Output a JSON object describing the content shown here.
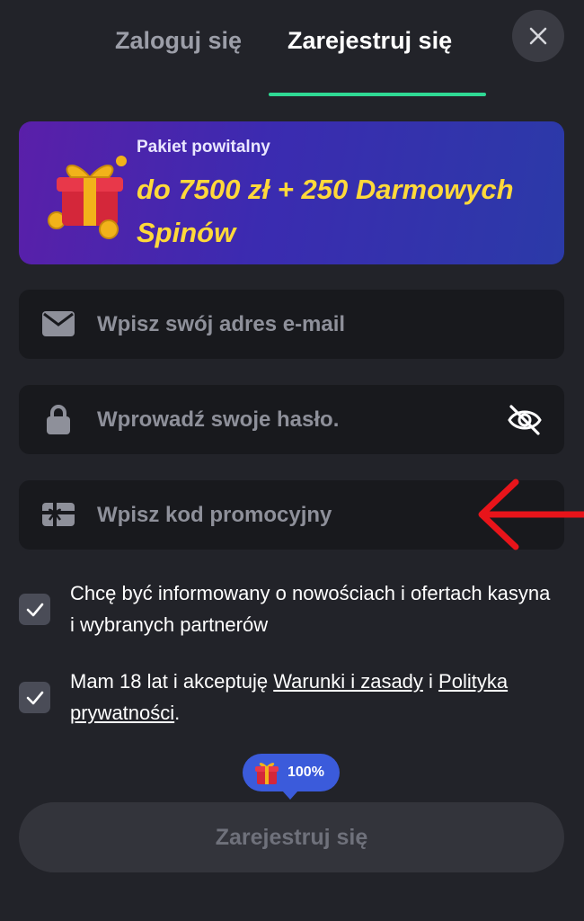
{
  "tabs": {
    "login": "Zaloguj się",
    "register": "Zarejestruj się"
  },
  "banner": {
    "subtitle": "Pakiet powitalny",
    "title": "do 7500 zł + 250 Darmowych Spinów"
  },
  "fields": {
    "email": {
      "placeholder": "Wpisz swój adres e-mail",
      "value": ""
    },
    "password": {
      "placeholder": "Wprowadź swoje hasło.",
      "value": ""
    },
    "promo": {
      "placeholder": "Wpisz kod promocyjny",
      "value": ""
    }
  },
  "checks": {
    "marketing": {
      "text": "Chcę być informowany o nowościach i ofertach kasyna i wybranych partnerów",
      "checked": true
    },
    "terms": {
      "prefix": "Mam 18 lat i akceptuję ",
      "link1": "Warunki i zasady",
      "middle": " i ",
      "link2": "Polityka prywatności",
      "suffix": ".",
      "checked": true
    }
  },
  "bonus": {
    "percent": "100%"
  },
  "submit": {
    "label": "Zarejestruj się"
  },
  "icons": {
    "close": "close-icon",
    "email": "envelope-icon",
    "password": "lock-icon",
    "promo": "gift-card-icon",
    "eye": "eye-off-icon"
  },
  "colors": {
    "accent": "#2fd994",
    "banner_title": "#ffd93a",
    "bonus_bubble": "#3b5bdb",
    "annotation_arrow": "#e8141a"
  }
}
